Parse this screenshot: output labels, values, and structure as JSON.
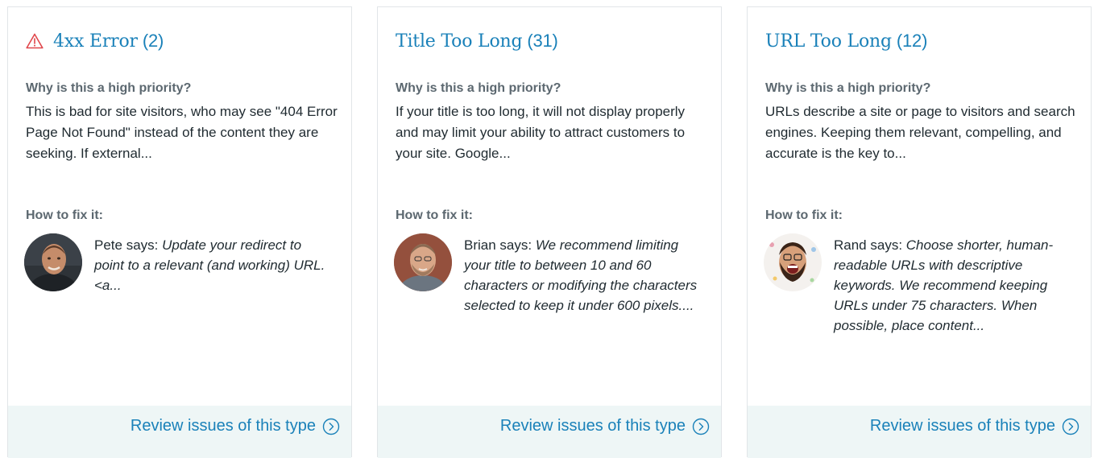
{
  "cards": [
    {
      "title": "4xx Error",
      "count": "(2)",
      "has_warning_icon": true,
      "why_label": "Why is this a high priority?",
      "why_text": "This is bad for site visitors, who may see \"404 Error Page Not Found\" instead of the content they are seeking. If external...",
      "fix_label": "How to fix it:",
      "expert": "Pete says:",
      "advice": "Update your redirect to point to a relevant (and working) URL. <a...",
      "review_label": "Review issues of this type"
    },
    {
      "title": "Title Too Long",
      "count": "(31)",
      "has_warning_icon": false,
      "why_label": "Why is this a high priority?",
      "why_text": "If your title is too long, it will not display properly and may limit your ability to attract customers to your site. Google...",
      "fix_label": "How to fix it:",
      "expert": "Brian says:",
      "advice": "We recommend limiting your title to between 10 and 60 characters or modifying the characters selected to keep it under 600 pixels....",
      "review_label": "Review issues of this type"
    },
    {
      "title": "URL Too Long",
      "count": "(12)",
      "has_warning_icon": false,
      "why_label": "Why is this a high priority?",
      "why_text": "URLs describe a site or page to visitors and search engines. Keeping them relevant, compelling, and accurate is the key to...",
      "fix_label": "How to fix it:",
      "expert": "Rand says:",
      "advice": "Choose shorter, human-readable URLs with descriptive keywords. We recommend keeping URLs under 75 characters. When possible, place content...",
      "review_label": "Review issues of this type"
    }
  ],
  "icons": {
    "warning": "warning-triangle-icon",
    "chevron": "chevron-right-circle-icon"
  },
  "colors": {
    "link": "#1a81b9",
    "warning": "#e0464b",
    "footer_bg": "#eef6f6",
    "card_border": "#e1e5e8"
  }
}
